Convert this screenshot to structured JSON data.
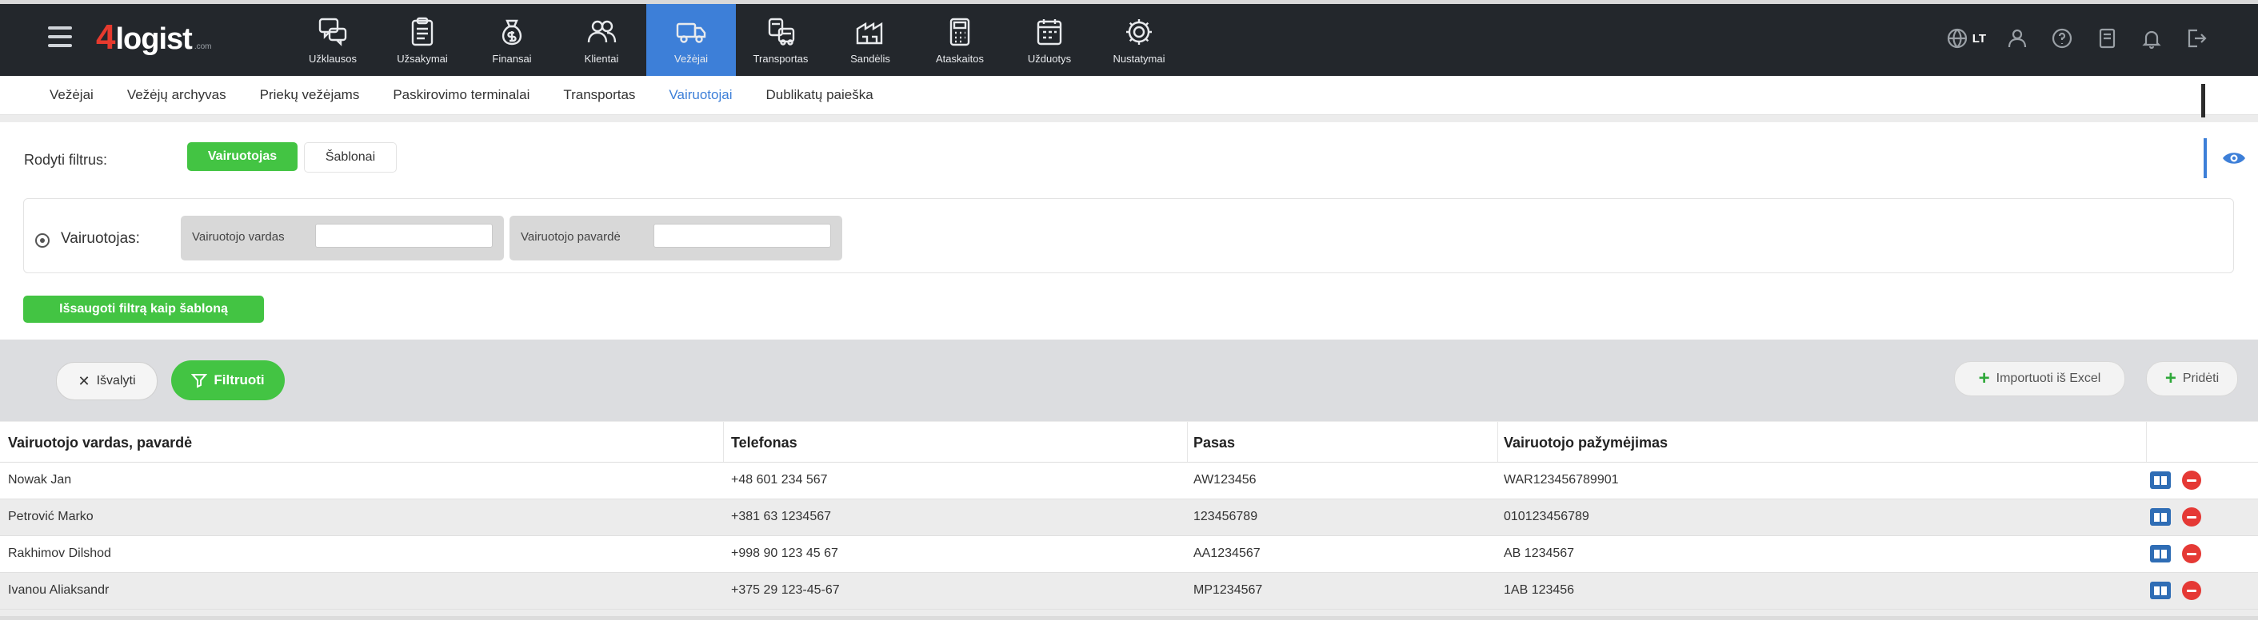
{
  "app": {
    "logo_digit": "4",
    "logo_word": "logist",
    "logo_sub": ".com"
  },
  "colors": {
    "topbar_bg": "#23272c",
    "active_nav": "#3d7fd8",
    "green": "#43c443",
    "delete_red": "#e53935",
    "edit_blue": "#2f6db5"
  },
  "topnav": {
    "items": [
      {
        "label": "Užklausos",
        "icon": "chat-bubbles-icon"
      },
      {
        "label": "Užsakymai",
        "icon": "clipboard-icon"
      },
      {
        "label": "Finansai",
        "icon": "money-bag-icon"
      },
      {
        "label": "Klientai",
        "icon": "users-icon"
      },
      {
        "label": "Vežėjai",
        "icon": "truck-icon",
        "active": true
      },
      {
        "label": "Transportas",
        "icon": "vehicles-icon"
      },
      {
        "label": "Sandėlis",
        "icon": "warehouse-icon"
      },
      {
        "label": "Ataskaitos",
        "icon": "calculator-icon"
      },
      {
        "label": "Užduotys",
        "icon": "calendar-icon"
      },
      {
        "label": "Nustatymai",
        "icon": "gear-icon"
      }
    ],
    "language": "LT",
    "right_icons": [
      "language-globe-icon",
      "user-icon",
      "help-icon",
      "notebook-icon",
      "bell-icon",
      "logout-icon"
    ]
  },
  "subnav": {
    "tabs": [
      {
        "label": "Vežėjai"
      },
      {
        "label": "Vežėjų archyvas"
      },
      {
        "label": "Priekų vežėjams"
      },
      {
        "label": "Paskirovimo terminalai"
      },
      {
        "label": "Transportas"
      },
      {
        "label": "Vairuotojai",
        "active": true
      },
      {
        "label": "Dublikatų paieška"
      }
    ]
  },
  "filters": {
    "show_label": "Rodyti filtrus:",
    "toggle_active": "Vairuotojas",
    "toggle_other": "Šablonai",
    "driver_label": "Vairuotojas:",
    "first_name_label": "Vairuotojo vardas",
    "first_name_value": "",
    "last_name_label": "Vairuotojo pavardė",
    "last_name_value": "",
    "save_template": "Išsaugoti filtrą kaip šabloną"
  },
  "actions": {
    "clear": "Išvalyti",
    "filter": "Filtruoti",
    "import_excel": "Importuoti iš Excel",
    "add": "Pridėti"
  },
  "table": {
    "headers": [
      "Vairuotojo vardas, pavardė",
      "Telefonas",
      "Pasas",
      "Vairuotojo pažymėjimas"
    ],
    "rows": [
      {
        "name": "Nowak Jan",
        "phone": "+48 601 234 567",
        "passport": "AW123456",
        "license": "WAR123456789901"
      },
      {
        "name": "Petrović Marko",
        "phone": "+381 63 1234567",
        "passport": "123456789",
        "license": "010123456789"
      },
      {
        "name": "Rakhimov Dilshod",
        "phone": "+998 90 123 45 67",
        "passport": "AA1234567",
        "license": "AB 1234567"
      },
      {
        "name": "Ivanou Aliaksandr",
        "phone": "+375 29 123-45-67",
        "passport": "MP1234567",
        "license": "1AB 123456"
      }
    ]
  }
}
